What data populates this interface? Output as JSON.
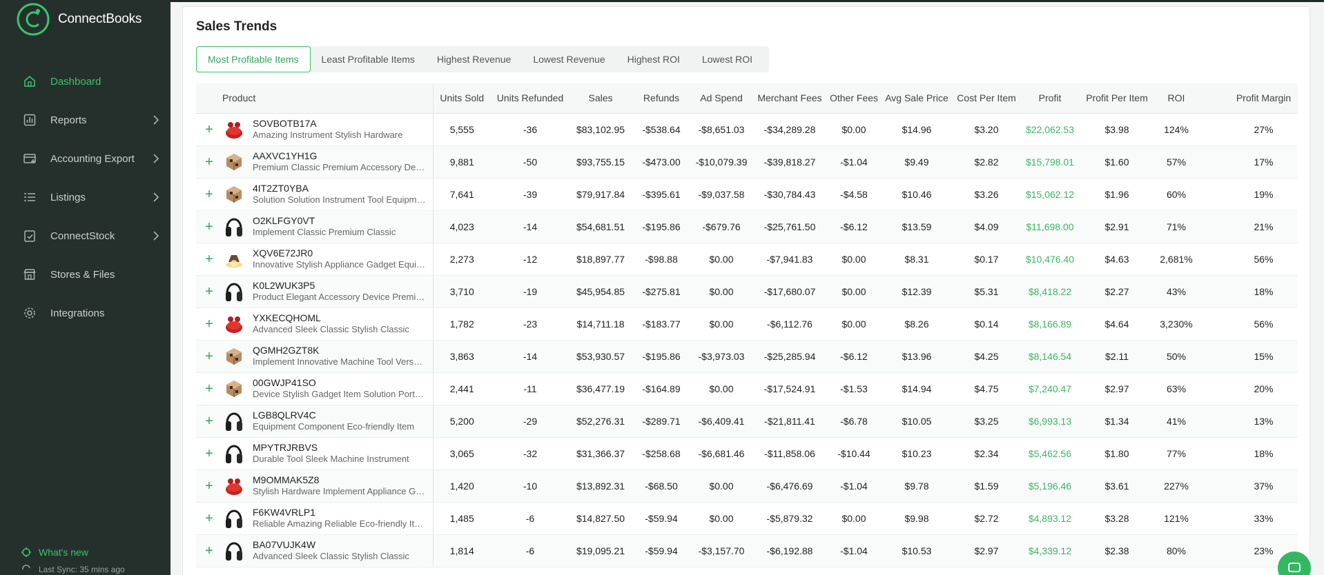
{
  "app": {
    "name": "ConnectBooks"
  },
  "sidebar": {
    "items": [
      {
        "label": "Dashboard",
        "icon": "home-icon",
        "active": true
      },
      {
        "label": "Reports",
        "icon": "reports-icon",
        "chevron": true
      },
      {
        "label": "Accounting Export",
        "icon": "accounting-export-icon",
        "chevron": true
      },
      {
        "label": "Listings",
        "icon": "listings-icon",
        "chevron": true
      },
      {
        "label": "ConnectStock",
        "icon": "connectstock-icon",
        "chevron": true
      },
      {
        "label": "Stores & Files",
        "icon": "store-icon"
      },
      {
        "label": "Integrations",
        "icon": "gear-icon"
      }
    ],
    "whats_new": "What's new",
    "last_sync": "Last Sync: 35 mins ago"
  },
  "main": {
    "title": "Sales Trends",
    "tabs": [
      {
        "label": "Most Profitable Items",
        "active": true
      },
      {
        "label": "Least Profitable Items"
      },
      {
        "label": "Highest Revenue"
      },
      {
        "label": "Lowest Revenue"
      },
      {
        "label": "Highest ROI"
      },
      {
        "label": "Lowest ROI"
      }
    ]
  },
  "table": {
    "columns": [
      "Product",
      "Units Sold",
      "Units Refunded",
      "Sales",
      "Refunds",
      "Ad Spend",
      "Merchant Fees",
      "Other Fees",
      "Avg Sale Price",
      "Cost Per Item",
      "Profit",
      "Profit Per Item",
      "ROI",
      "Profit Margin"
    ],
    "rows": [
      {
        "thumb": "red-earbuds",
        "sku": "SOVBOTB17A",
        "name": "Amazing Instrument Stylish Hardware",
        "cells": [
          "5,555",
          "-36",
          "$83,102.95",
          "-$538.64",
          "-$8,651.03",
          "-$34,289.28",
          "$0.00",
          "$14.96",
          "$3.20",
          "$22,062.53",
          "$3.98",
          "124%",
          "27%"
        ]
      },
      {
        "thumb": "cube",
        "sku": "AAXVC1YH1G",
        "name": "Premium Classic Premium Accessory Device",
        "cells": [
          "9,881",
          "-50",
          "$93,755.15",
          "-$473.00",
          "-$10,079.39",
          "-$39,818.27",
          "-$1.04",
          "$9.49",
          "$2.82",
          "$15,798.01",
          "$1.60",
          "57%",
          "17%"
        ]
      },
      {
        "thumb": "cube",
        "sku": "4IT2ZT0YBA",
        "name": "Solution Solution Instrument Tool Equipment",
        "cells": [
          "7,641",
          "-39",
          "$79,917.84",
          "-$395.61",
          "-$9,037.58",
          "-$30,784.43",
          "-$4.58",
          "$10.46",
          "$3.26",
          "$15,062.12",
          "$1.96",
          "60%",
          "19%"
        ]
      },
      {
        "thumb": "headphones",
        "sku": "O2KLFGY0VT",
        "name": "Implement Classic Premium Classic",
        "cells": [
          "4,023",
          "-14",
          "$54,681.51",
          "-$195.86",
          "-$679.76",
          "-$25,761.50",
          "-$6.12",
          "$13.59",
          "$4.09",
          "$11,698.00",
          "$2.91",
          "71%",
          "21%"
        ]
      },
      {
        "thumb": "lamp",
        "sku": "XQV6E72JR0",
        "name": "Innovative Stylish Appliance Gadget Equipment",
        "cells": [
          "2,273",
          "-12",
          "$18,897.77",
          "-$98.88",
          "$0.00",
          "-$7,941.83",
          "$0.00",
          "$8.31",
          "$0.17",
          "$10,476.40",
          "$4.63",
          "2,681%",
          "56%"
        ]
      },
      {
        "thumb": "headphones",
        "sku": "K0L2WUK3P5",
        "name": "Product Elegant Accessory Device Premium",
        "cells": [
          "3,710",
          "-19",
          "$45,954.85",
          "-$275.81",
          "$0.00",
          "-$17,680.07",
          "$0.00",
          "$12.39",
          "$5.31",
          "$8,418.22",
          "$2.27",
          "43%",
          "18%"
        ]
      },
      {
        "thumb": "red-earbuds",
        "sku": "YXKECQHOML",
        "name": "Advanced Sleek Classic Stylish Classic",
        "cells": [
          "1,782",
          "-23",
          "$14,711.18",
          "-$183.77",
          "$0.00",
          "-$6,112.76",
          "$0.00",
          "$8.26",
          "$0.14",
          "$8,166.89",
          "$4.64",
          "3,230%",
          "56%"
        ]
      },
      {
        "thumb": "cube",
        "sku": "QGMH2GZT8K",
        "name": "Implement Innovative Machine Tool Versatile",
        "cells": [
          "3,863",
          "-14",
          "$53,930.57",
          "-$195.86",
          "-$3,973.03",
          "-$25,285.94",
          "-$6.12",
          "$13.96",
          "$4.25",
          "$8,146.54",
          "$2.11",
          "50%",
          "15%"
        ]
      },
      {
        "thumb": "cube",
        "sku": "00GWJP41SO",
        "name": "Device Stylish Gadget Item Solution Portable",
        "cells": [
          "2,441",
          "-11",
          "$36,477.19",
          "-$164.89",
          "$0.00",
          "-$17,524.91",
          "-$1.53",
          "$14.94",
          "$4.75",
          "$7,240.47",
          "$2.97",
          "63%",
          "20%"
        ]
      },
      {
        "thumb": "headphones",
        "sku": "LGB8QLRV4C",
        "name": "Equipment Component Eco-friendly Item",
        "cells": [
          "5,200",
          "-29",
          "$52,276.31",
          "-$289.71",
          "-$6,409.41",
          "-$21,811.41",
          "-$6.78",
          "$10.05",
          "$3.25",
          "$6,993.13",
          "$1.34",
          "41%",
          "13%"
        ]
      },
      {
        "thumb": "headphones",
        "sku": "MPYTRJRBVS",
        "name": "Durable Tool Sleek Machine Instrument",
        "cells": [
          "3,065",
          "-32",
          "$31,366.37",
          "-$258.68",
          "-$6,681.46",
          "-$11,858.06",
          "-$10.44",
          "$10.23",
          "$2.34",
          "$5,462.56",
          "$1.80",
          "77%",
          "18%"
        ]
      },
      {
        "thumb": "red-earbuds",
        "sku": "M9OMMAK5Z8",
        "name": "Stylish Hardware Implement Appliance Gadget",
        "cells": [
          "1,420",
          "-10",
          "$13,892.31",
          "-$68.50",
          "$0.00",
          "-$6,476.69",
          "-$1.04",
          "$9.78",
          "$1.59",
          "$5,196.46",
          "$3.61",
          "227%",
          "37%"
        ]
      },
      {
        "thumb": "headphones",
        "sku": "F6KW4VRLP1",
        "name": "Reliable Amazing Reliable Eco-friendly Item",
        "cells": [
          "1,485",
          "-6",
          "$14,827.50",
          "-$59.94",
          "$0.00",
          "-$5,879.32",
          "$0.00",
          "$9.98",
          "$2.72",
          "$4,893.12",
          "$3.28",
          "121%",
          "33%"
        ]
      },
      {
        "thumb": "headphones",
        "sku": "BA07VUJK4W",
        "name": "Advanced Sleek Classic Stylish Classic",
        "cells": [
          "1,814",
          "-6",
          "$19,095.21",
          "-$59.94",
          "-$3,157.70",
          "-$6,192.88",
          "-$1.04",
          "$10.53",
          "$2.97",
          "$4,339.12",
          "$2.38",
          "80%",
          "23%"
        ]
      }
    ]
  },
  "colors": {
    "accent": "#3bc46a",
    "sidebar_bg": "#25302d",
    "profit": "#3bb662"
  }
}
